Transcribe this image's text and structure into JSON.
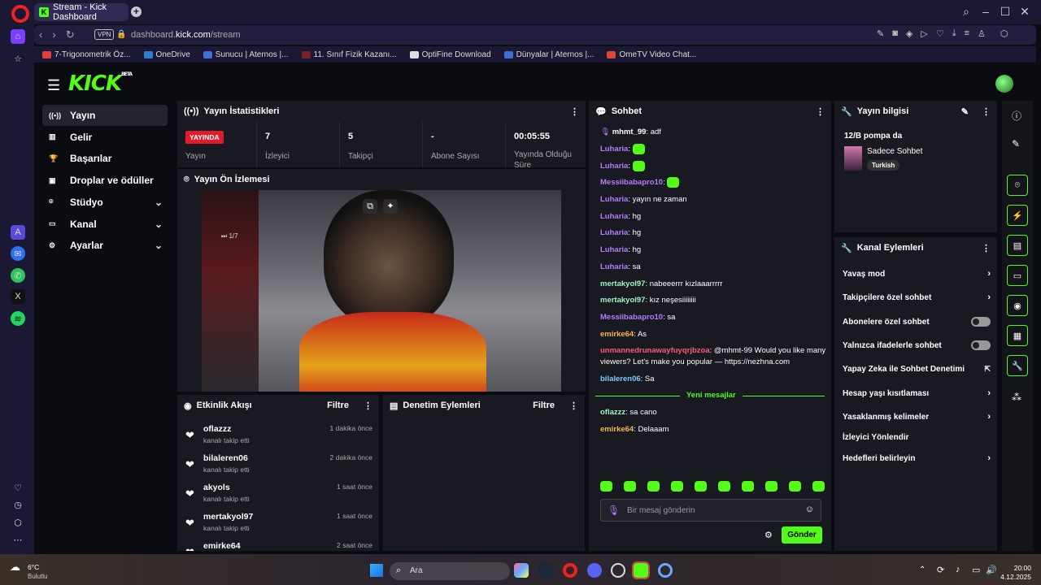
{
  "browser": {
    "tab_title": "Stream - Kick Dashboard",
    "vpn_label": "VPN",
    "url_prefix": "dashboard.",
    "url_domain": "kick.com",
    "url_path": "/stream",
    "bookmarks": [
      {
        "label": "7-Trigonometrik Öz...",
        "color": "#e04040"
      },
      {
        "label": "OneDrive",
        "color": "#2d7dd2"
      },
      {
        "label": "Sunucu | Aternos |...",
        "color": "#3d6fd6"
      },
      {
        "label": "11. Sınıf Fizik Kazanı...",
        "color": "#7a2020"
      },
      {
        "label": "OptiFine Download",
        "color": "#dddddd"
      },
      {
        "label": "Dünyalar | Aternos |...",
        "color": "#3d6fd6"
      },
      {
        "label": "OmeTV Video Chat...",
        "color": "#d84a3a"
      }
    ]
  },
  "kick": {
    "logo": "KICK",
    "logo_badge": "BETA",
    "nav": [
      {
        "label": "Yayın",
        "icon": "broadcast-icon",
        "active": true
      },
      {
        "label": "Gelir",
        "icon": "revenue-icon"
      },
      {
        "label": "Başarılar",
        "icon": "trophy-icon"
      },
      {
        "label": "Droplar ve ödüller",
        "icon": "gift-icon"
      },
      {
        "label": "Stüdyo",
        "icon": "studio-icon",
        "chevron": true
      },
      {
        "label": "Kanal",
        "icon": "channel-icon",
        "chevron": true
      },
      {
        "label": "Ayarlar",
        "icon": "gear-icon",
        "chevron": true
      }
    ],
    "stats": {
      "title": "Yayın İstatistikleri",
      "live_badge": "YAYINDA",
      "live_label": "Yayın",
      "items": [
        {
          "value": "7",
          "label": "İzleyici"
        },
        {
          "value": "5",
          "label": "Takipçi"
        },
        {
          "value": "-",
          "label": "Abone Sayısı"
        },
        {
          "value": "00:05:55",
          "label": "Yayında Olduğu Süre"
        }
      ]
    },
    "preview": {
      "title": "Yayın Ön İzlemesi",
      "video_counter": "1/7"
    },
    "activity": {
      "title": "Etkinlik Akışı",
      "filter": "Filtre",
      "items": [
        {
          "name": "oflazzz",
          "sub": "kanalı takip etti",
          "time": "1 dakika önce"
        },
        {
          "name": "bilaleren06",
          "sub": "kanalı takip etti",
          "time": "2 dakika önce"
        },
        {
          "name": "akyols",
          "sub": "kanalı takip etti",
          "time": "1 saat önce"
        },
        {
          "name": "mertakyol97",
          "sub": "kanalı takip etti",
          "time": "1 saat önce"
        },
        {
          "name": "emirke64",
          "sub": "",
          "time": "2 saat önce"
        }
      ]
    },
    "moderation": {
      "title": "Denetim Eylemleri",
      "filter": "Filtre"
    },
    "chat": {
      "title": "Sohbet",
      "messages": [
        {
          "user": "mhmt_99",
          "text": "adf",
          "color": "#ffffff",
          "mic": true
        },
        {
          "user": "Luharia",
          "text": "",
          "color": "#b77cff",
          "emote": true
        },
        {
          "user": "Luharia",
          "text": "",
          "color": "#b77cff",
          "emote": true
        },
        {
          "user": "Messiibabapro10",
          "text": "",
          "color": "#b77cff",
          "emote": true
        },
        {
          "user": "Luharia",
          "text": "yayın ne zaman",
          "color": "#b77cff"
        },
        {
          "user": "Luharia",
          "text": "hg",
          "color": "#b77cff"
        },
        {
          "user": "Luharia",
          "text": "hg",
          "color": "#b77cff"
        },
        {
          "user": "Luharia",
          "text": "hg",
          "color": "#b77cff"
        },
        {
          "user": "Luharia",
          "text": "sa",
          "color": "#b77cff"
        },
        {
          "user": "mertakyol97",
          "text": "nabeeerrr kızlaaarrrrr",
          "color": "#9ef5c2"
        },
        {
          "user": "mertakyol97",
          "text": "kız neşesiiiiiiii",
          "color": "#9ef5c2"
        },
        {
          "user": "Messiibabapro10",
          "text": "sa",
          "color": "#b77cff"
        },
        {
          "user": "emirke64",
          "text": "As",
          "color": "#f2b84b"
        },
        {
          "user": "unmannedrunawayfuyqrjbzoa",
          "text": "@mhmt-99 Would you like many viewers? Let's make you popular — https://nezhna.com",
          "color": "#ff5a7a"
        },
        {
          "user": "bilaleren06",
          "text": "Sa",
          "color": "#7ec8ff"
        }
      ],
      "new_messages_label": "Yeni mesajlar",
      "new_messages": [
        {
          "user": "oflazzz",
          "text": "sa cano",
          "color": "#9ef5c2"
        },
        {
          "user": "emirke64",
          "text": "Delaaam",
          "color": "#f2b84b"
        }
      ],
      "placeholder": "Bir mesaj gönderin",
      "send": "Gönder"
    },
    "stream_info": {
      "title": "Yayın bilgisi",
      "stream_title": "12/B pompa da",
      "category": "Sadece Sohbet",
      "language": "Turkish"
    },
    "channel_actions": {
      "title": "Kanal Eylemleri",
      "items": [
        {
          "label": "Yavaş mod",
          "type": "arrow"
        },
        {
          "label": "Takipçilere özel sohbet",
          "type": "arrow"
        },
        {
          "label": "Abonelere özel sohbet",
          "type": "toggle"
        },
        {
          "label": "Yalnızca ifadelerle sohbet",
          "type": "toggle"
        },
        {
          "label": "Yapay Zeka ile Sohbet Denetimi",
          "type": "external"
        },
        {
          "label": "Hesap yaşı kısıtlaması",
          "type": "arrow"
        },
        {
          "label": "Yasaklanmış kelimeler",
          "type": "arrow"
        },
        {
          "label": "İzleyici Yönlendir",
          "type": "none"
        },
        {
          "label": "Hedefleri belirleyin",
          "type": "arrow"
        }
      ]
    }
  },
  "taskbar": {
    "weather_temp": "6°C",
    "weather_desc": "Bulutlu",
    "search": "Ara",
    "time": "20:00",
    "date": "4.12.2025"
  }
}
